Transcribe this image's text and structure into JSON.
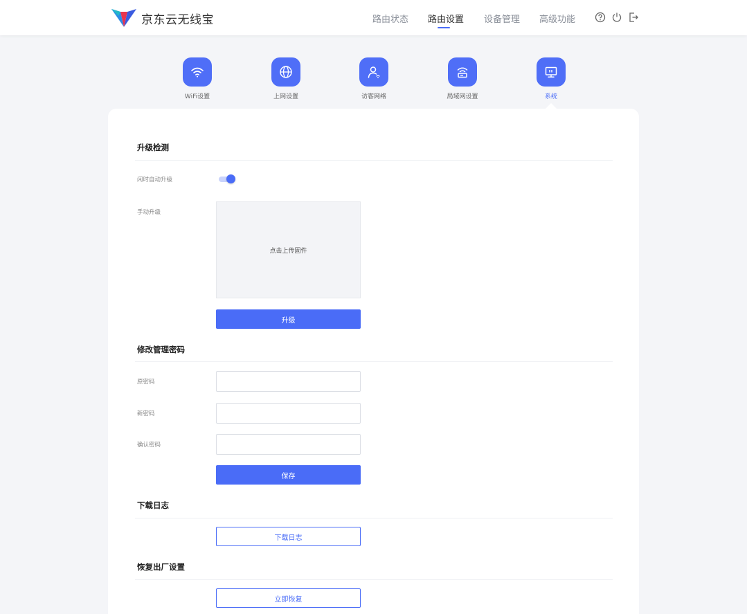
{
  "header": {
    "brand": "京东云无线宝",
    "nav": [
      "路由状态",
      "路由设置",
      "设备管理",
      "高级功能"
    ],
    "active_nav": "路由设置",
    "icons": [
      "help-icon",
      "power-icon",
      "logout-icon"
    ]
  },
  "categories": [
    {
      "label": "WiFi设置",
      "icon": "wifi-icon"
    },
    {
      "label": "上网设置",
      "icon": "globe-icon"
    },
    {
      "label": "访客网络",
      "icon": "guest-icon"
    },
    {
      "label": "局域网设置",
      "icon": "lan-router-icon"
    },
    {
      "label": "系统",
      "icon": "system-monitor-icon"
    }
  ],
  "active_category": "系统",
  "upgrade": {
    "title": "升级检测",
    "auto_label": "闲时自动升级",
    "auto_enabled": true,
    "manual_label": "手动升级",
    "upload_text": "点击上传固件",
    "button": "升级"
  },
  "password": {
    "title": "修改管理密码",
    "old_label": "原密码",
    "new_label": "新密码",
    "confirm_label": "确认密码",
    "old_value": "",
    "new_value": "",
    "confirm_value": "",
    "button": "保存"
  },
  "logs": {
    "title": "下载日志",
    "button": "下载日志"
  },
  "reset": {
    "title": "恢复出厂设置",
    "button": "立即恢复"
  },
  "colors": {
    "accent": "#4a6cf7",
    "background": "#f4f5f8"
  }
}
